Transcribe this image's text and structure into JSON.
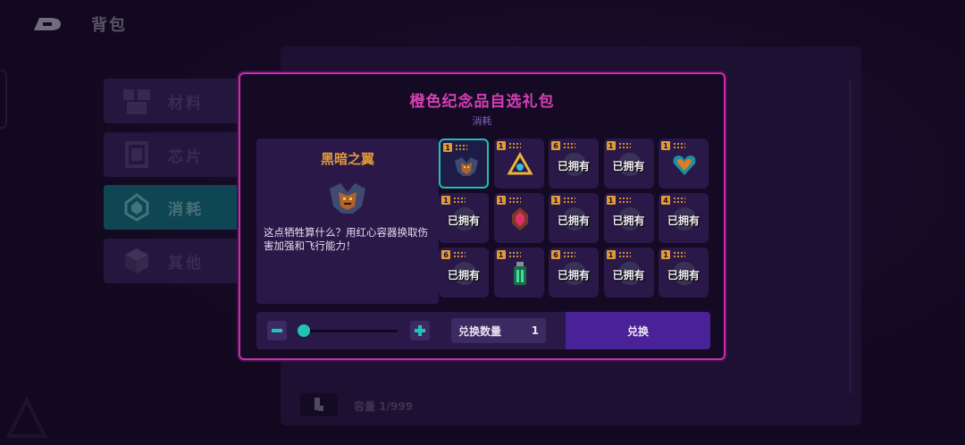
{
  "header": {
    "title": "背包"
  },
  "categories": [
    {
      "label": "材料",
      "icon": "materials-icon",
      "active": false
    },
    {
      "label": "芯片",
      "icon": "chip-icon",
      "active": false
    },
    {
      "label": "消耗",
      "icon": "consumable-icon",
      "active": true
    },
    {
      "label": "其他",
      "icon": "box-icon",
      "active": false
    }
  ],
  "backpanel": {
    "capacity": "容量 1/999"
  },
  "modal": {
    "title": "橙色纪念品自选礼包",
    "subtitle": "消耗",
    "selected_item": {
      "name": "黑暗之翼",
      "description": "这点牺牲算什么？用红心容器换取伤害加强和飞行能力！"
    },
    "items": [
      {
        "qty": "1",
        "owned": "",
        "icon": "dark-wings-icon",
        "selected": true
      },
      {
        "qty": "1",
        "owned": "",
        "icon": "triangle-crystal-icon",
        "selected": false
      },
      {
        "qty": "6",
        "owned": "已拥有",
        "icon": "relic-icon",
        "selected": false
      },
      {
        "qty": "1",
        "owned": "已拥有",
        "icon": "relic-icon",
        "selected": false
      },
      {
        "qty": "1",
        "owned": "",
        "icon": "heart-container-icon",
        "selected": false
      },
      {
        "qty": "1",
        "owned": "已拥有",
        "icon": "relic-icon",
        "selected": false
      },
      {
        "qty": "1",
        "owned": "",
        "icon": "red-gem-icon",
        "selected": false
      },
      {
        "qty": "1",
        "owned": "已拥有",
        "icon": "relic-icon",
        "selected": false
      },
      {
        "qty": "1",
        "owned": "已拥有",
        "icon": "relic-icon",
        "selected": false
      },
      {
        "qty": "4",
        "owned": "已拥有",
        "icon": "relic-icon",
        "selected": false
      },
      {
        "qty": "6",
        "owned": "已拥有",
        "icon": "relic-icon",
        "selected": false
      },
      {
        "qty": "1",
        "owned": "",
        "icon": "green-potion-icon",
        "selected": false
      },
      {
        "qty": "6",
        "owned": "已拥有",
        "icon": "relic-icon",
        "selected": false
      },
      {
        "qty": "1",
        "owned": "已拥有",
        "icon": "relic-icon",
        "selected": false
      },
      {
        "qty": "1",
        "owned": "已拥有",
        "icon": "relic-icon",
        "selected": false
      }
    ],
    "exchange": {
      "minus": "−",
      "plus": "+",
      "slider_level": 0,
      "quantity_label": "兑换数量",
      "quantity_value": "1",
      "button_label": "兑换"
    }
  },
  "colors": {
    "modal_border": "#d12ab0",
    "title": "#d63fb4",
    "item_name": "#e09a36",
    "accent_teal": "#1fc4b4",
    "exchange_button": "#4a2298"
  }
}
